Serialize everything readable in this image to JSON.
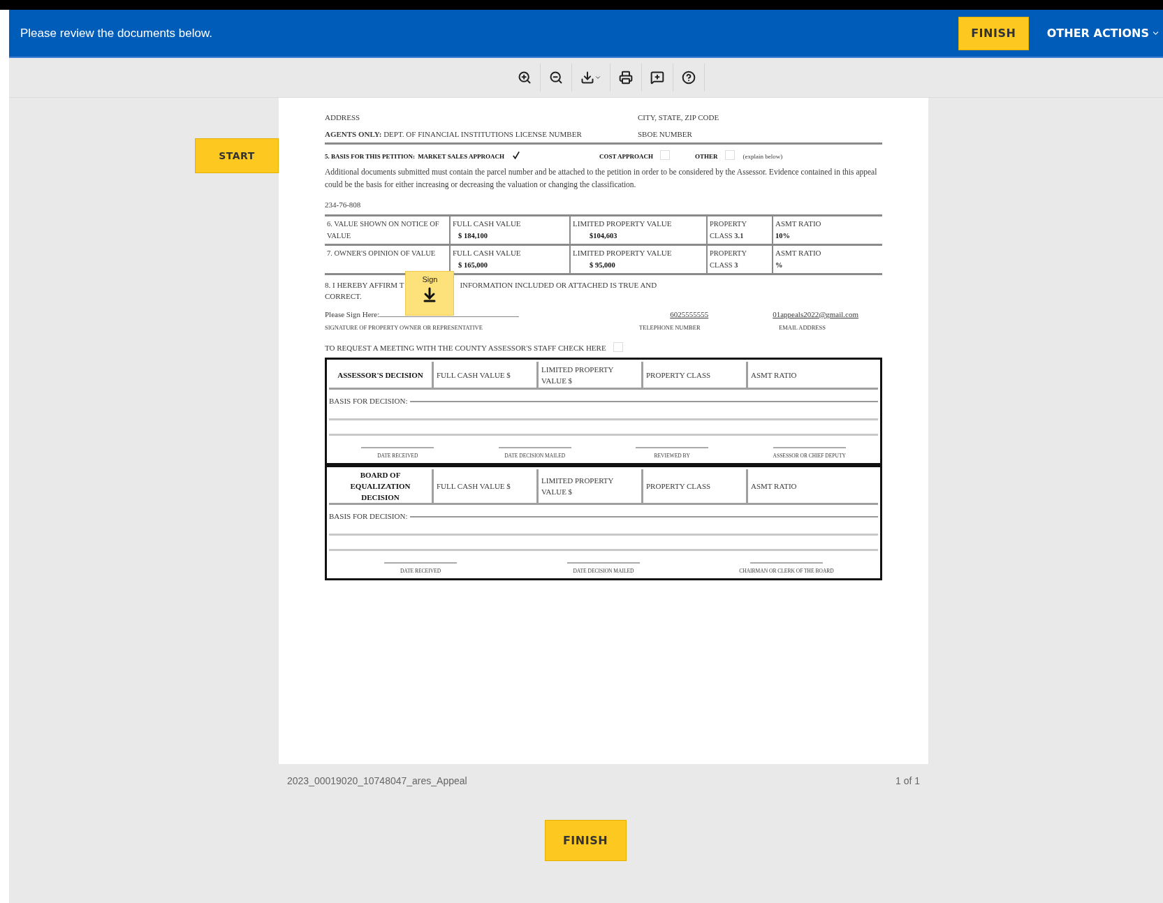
{
  "header": {
    "message": "Please review the documents below.",
    "finish_button": "FINISH",
    "other_actions": "OTHER ACTIONS"
  },
  "start_button": "START",
  "form": {
    "address_row": [
      "ADDRESS",
      "CITY, STATE, ZIP CODE"
    ],
    "agent_row": {
      "label": "**AGENTS ONLY:** DEPT. OF FINANCIAL INSTITUTIONS LICENSE NUMBER",
      "right": "SBOE NUMBER"
    },
    "basis": {
      "title": "5. BASIS FOR THIS PETITION:",
      "note": "(explain below)",
      "options": [
        {
          "label": "MARKET SALES APPROACH",
          "checked": true
        },
        {
          "label": "COST APPROACH",
          "checked": false
        },
        {
          "label": "OTHER",
          "checked": false
        }
      ]
    },
    "notice": "Additional documents submitted must contain the parcel number and be attached to the petition in order to be considered by the Assessor. Evidence contained in this appeal could be the basis for either increasing or decreasing the valuation or changing the classification.",
    "parcel": "234-76-808",
    "value_rows": [
      {
        "label": "6. VALUE SHOWN ON NOTICE OF VALUE",
        "full_cash_label": "FULL CASH VALUE",
        "full_cash": "$ 184,100",
        "limited_label": "LIMITED PROPERTY VALUE",
        "limited": "$104,603",
        "property_class": "PROPERTY CLASS **3.1**",
        "ratio_label": "ASMT RATIO",
        "ratio": "10%"
      },
      {
        "label": "7. OWNER'S OPINION OF VALUE",
        "full_cash_label": "FULL CASH VALUE",
        "full_cash": "$ 165,000",
        "limited_label": "LIMITED PROPERTY VALUE",
        "limited": "$ 95,000",
        "property_class": "PROPERTY CLASS **3**",
        "ratio_label": "ASMT RATIO",
        "ratio": "%"
      }
    ],
    "affirm": {
      "before": "8. I HEREBY AFFIRM T",
      "after": "INFORMATION INCLUDED OR ATTACHED IS TRUE AND",
      "end": "CORRECT."
    },
    "sign_tag": "Sign",
    "sign_row": {
      "prompt": "Please Sign Here:",
      "phone": "6025555555",
      "email": "01appeals2022@gmail.com"
    },
    "captions": [
      "SIGNATURE OF PROPERTY OWNER OR REPRESENTATIVE",
      "TELEPHONE NUMBER",
      "EMAIL ADDRESS"
    ],
    "meeting": {
      "label": "TO REQUEST A MEETING WITH THE COUNTY ASSESSOR'S STAFF CHECK HERE",
      "checked": false
    },
    "decisions": [
      {
        "title": "ASSESSOR'S DECISION",
        "columns": [
          "FULL CASH VALUE $",
          "LIMITED PROPERTY VALUE $",
          "PROPERTY CLASS",
          "ASMT RATIO"
        ],
        "basis": "BASIS FOR DECISION:",
        "signatures": [
          "DATE RECEIVED",
          "DATE DECISION MAILED",
          "REVIEWED BY",
          "ASSESSOR OR CHIEF DEPUTY"
        ]
      },
      {
        "title": "BOARD OF EQUALIZATION DECISION",
        "columns": [
          "FULL CASH VALUE $",
          "LIMITED PROPERTY VALUE $",
          "PROPERTY CLASS",
          "ASMT RATIO"
        ],
        "basis": "BASIS FOR DECISION:",
        "signatures": [
          "DATE RECEIVED",
          "DATE DECISION MAILED",
          "CHAIRMAN OR CLERK OF THE BOARD"
        ]
      }
    ]
  },
  "footer": {
    "filename": "2023_00019020_10748047_ares_Appeal",
    "pages": "1 of 1",
    "finish_button": "FINISH"
  }
}
